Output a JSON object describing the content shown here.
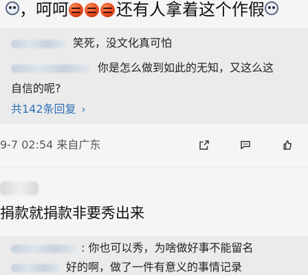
{
  "top": {
    "prefix": "，呵呵",
    "suffix": "还有人拿着这个作假"
  },
  "reply_block_1": {
    "line1_text": "笑死，没文化真可怕",
    "line2_text": "你是怎么做到如此的无知，又这么这",
    "line3_text": "自信的呢?",
    "more_replies": "共142条回复"
  },
  "meta": {
    "date_location": "9-7 02:54  来自广东"
  },
  "comment_2": {
    "text": "捐款就捐款非要秀出来"
  },
  "reply_block_2": {
    "line1_text": ": 你也可以秀，为啥做好事不能留名",
    "line2_text": "好的啊，做了一件有意义的事情记录"
  }
}
